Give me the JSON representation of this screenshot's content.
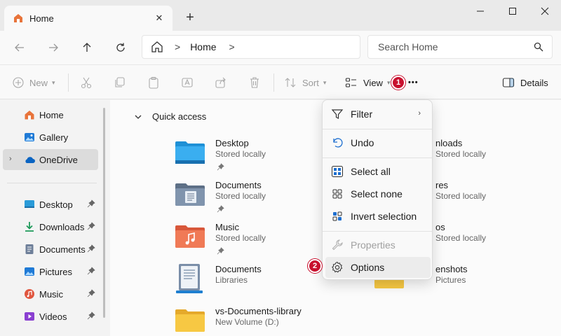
{
  "window": {
    "tab_label": "Home",
    "tab_close": "✕",
    "new_tab": "+",
    "minimize": "—",
    "close": "✕"
  },
  "navigation": {
    "breadcrumb_sep": ">",
    "breadcrumb": "Home",
    "search_placeholder": "Search Home"
  },
  "toolbar": {
    "new_label": "New",
    "sort_label": "Sort",
    "view_label": "View",
    "more_label": "•••",
    "details_label": "Details",
    "badge_1": "1"
  },
  "sidebar": {
    "home": "Home",
    "gallery": "Gallery",
    "onedrive": "OneDrive",
    "desktop": "Desktop",
    "downloads": "Downloads",
    "documents": "Documents",
    "pictures": "Pictures",
    "music": "Music",
    "videos": "Videos"
  },
  "content": {
    "section_title": "Quick access",
    "items": [
      {
        "name": "Desktop",
        "sub": "Stored locally"
      },
      {
        "name": "Documents",
        "sub": "Stored locally"
      },
      {
        "name": "Music",
        "sub": "Stored locally"
      },
      {
        "name": "Documents",
        "sub": "Libraries"
      },
      {
        "name": "vs-Documents-library",
        "sub": "New Volume (D:)"
      }
    ],
    "right_items": [
      {
        "name": "nloads",
        "sub": "Stored locally"
      },
      {
        "name": "res",
        "sub": "Stored locally"
      },
      {
        "name": "os",
        "sub": "Stored locally"
      },
      {
        "name": "enshots",
        "sub": "Pictures"
      }
    ]
  },
  "menu": {
    "filter": "Filter",
    "undo": "Undo",
    "select_all": "Select all",
    "select_none": "Select none",
    "invert_selection": "Invert selection",
    "properties": "Properties",
    "options": "Options",
    "badge_2": "2"
  },
  "colors": {
    "accent": "#0067c0",
    "badge": "#c8102e",
    "folder_yellow": "#f7c843"
  }
}
